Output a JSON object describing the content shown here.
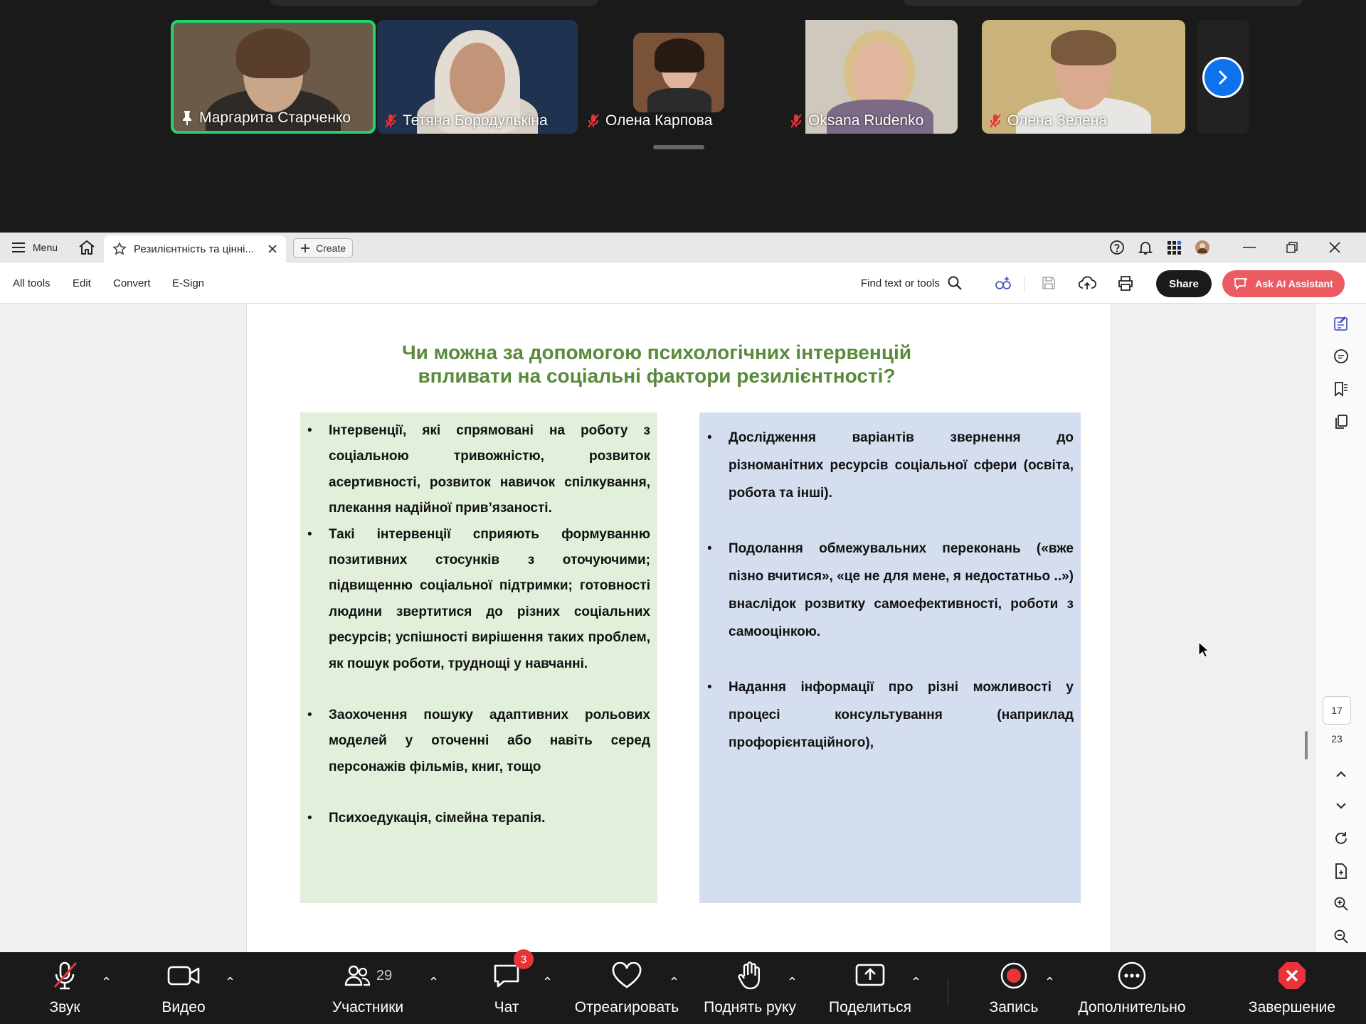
{
  "zoom_top": {
    "participants": [
      {
        "name": "Маргарита Старченко",
        "pinned": true,
        "muted": false,
        "active": true
      },
      {
        "name": "Тетяна Бородулькіна",
        "pinned": false,
        "muted": true,
        "active": false
      },
      {
        "name": "Олена Карпова",
        "pinned": false,
        "muted": true,
        "active": false
      },
      {
        "name": "Oksana Rudenko",
        "pinned": false,
        "muted": true,
        "active": false
      },
      {
        "name": "Олена Зелена",
        "pinned": false,
        "muted": true,
        "active": false
      }
    ]
  },
  "acrobat": {
    "menu_label": "Menu",
    "tab_title": "Резилієнтність та цінні...",
    "create_label": "Create",
    "tools": {
      "all_tools": "All tools",
      "edit": "Edit",
      "convert": "Convert",
      "esign": "E-Sign"
    },
    "find_label": "Find text or tools",
    "share_label": "Share",
    "ai_label": "Ask AI Assistant",
    "page_current": "17",
    "page_total": "23"
  },
  "slide": {
    "title_line1": "Чи можна за допомогою психологічних інтервенцій",
    "title_line2": "впливати на соціальні фактори резилієнтності?",
    "left_bullets": [
      "Інтервенції, які спрямовані на роботу з соціальною тривожністю, розвиток асертивності, розвиток навичок спілкування, плекання надійної прив’язаності.",
      "Такі інтервенції сприяють формуванню позитивних стосунків з оточуючими; підвищенню соціальної підтримки; готовності людини звертитися до різних соціальних ресурсів; успішності вирішення таких проблем, як пошук роботи, труднощі у навчанні.",
      "Заохочення пошуку адаптивних рольових моделей у оточенні або навіть серед персонажів фільмів, книг, тощо",
      "Психоедукація, сімейна терапія."
    ],
    "right_bullets": [
      "Дослідження варіантів звернення до різноманітних ресурсів соціальної сфери (освіта, робота та інші).",
      "Подолання обмежувальних переконань («вже пізно вчитися», «це не для мене, я недостатньо ..») внаслідок розвитку самоефективності, роботи з самооцінкою.",
      "Надання інформації про різні можливості у процесі консультування (наприклад профорієнтаційного),"
    ],
    "colors": {
      "title": "#5a8a3a",
      "left_panel": "#e2efda",
      "right_panel": "#d4deef"
    }
  },
  "zoom_bar": {
    "audio": "Звук",
    "video": "Видео",
    "participants": "Участники",
    "participants_count": "29",
    "chat": "Чат",
    "chat_badge": "3",
    "react": "Отреагировать",
    "raise_hand": "Поднять руку",
    "share": "Поделиться",
    "record": "Запись",
    "more": "Дополнительно",
    "end": "Завершение"
  }
}
